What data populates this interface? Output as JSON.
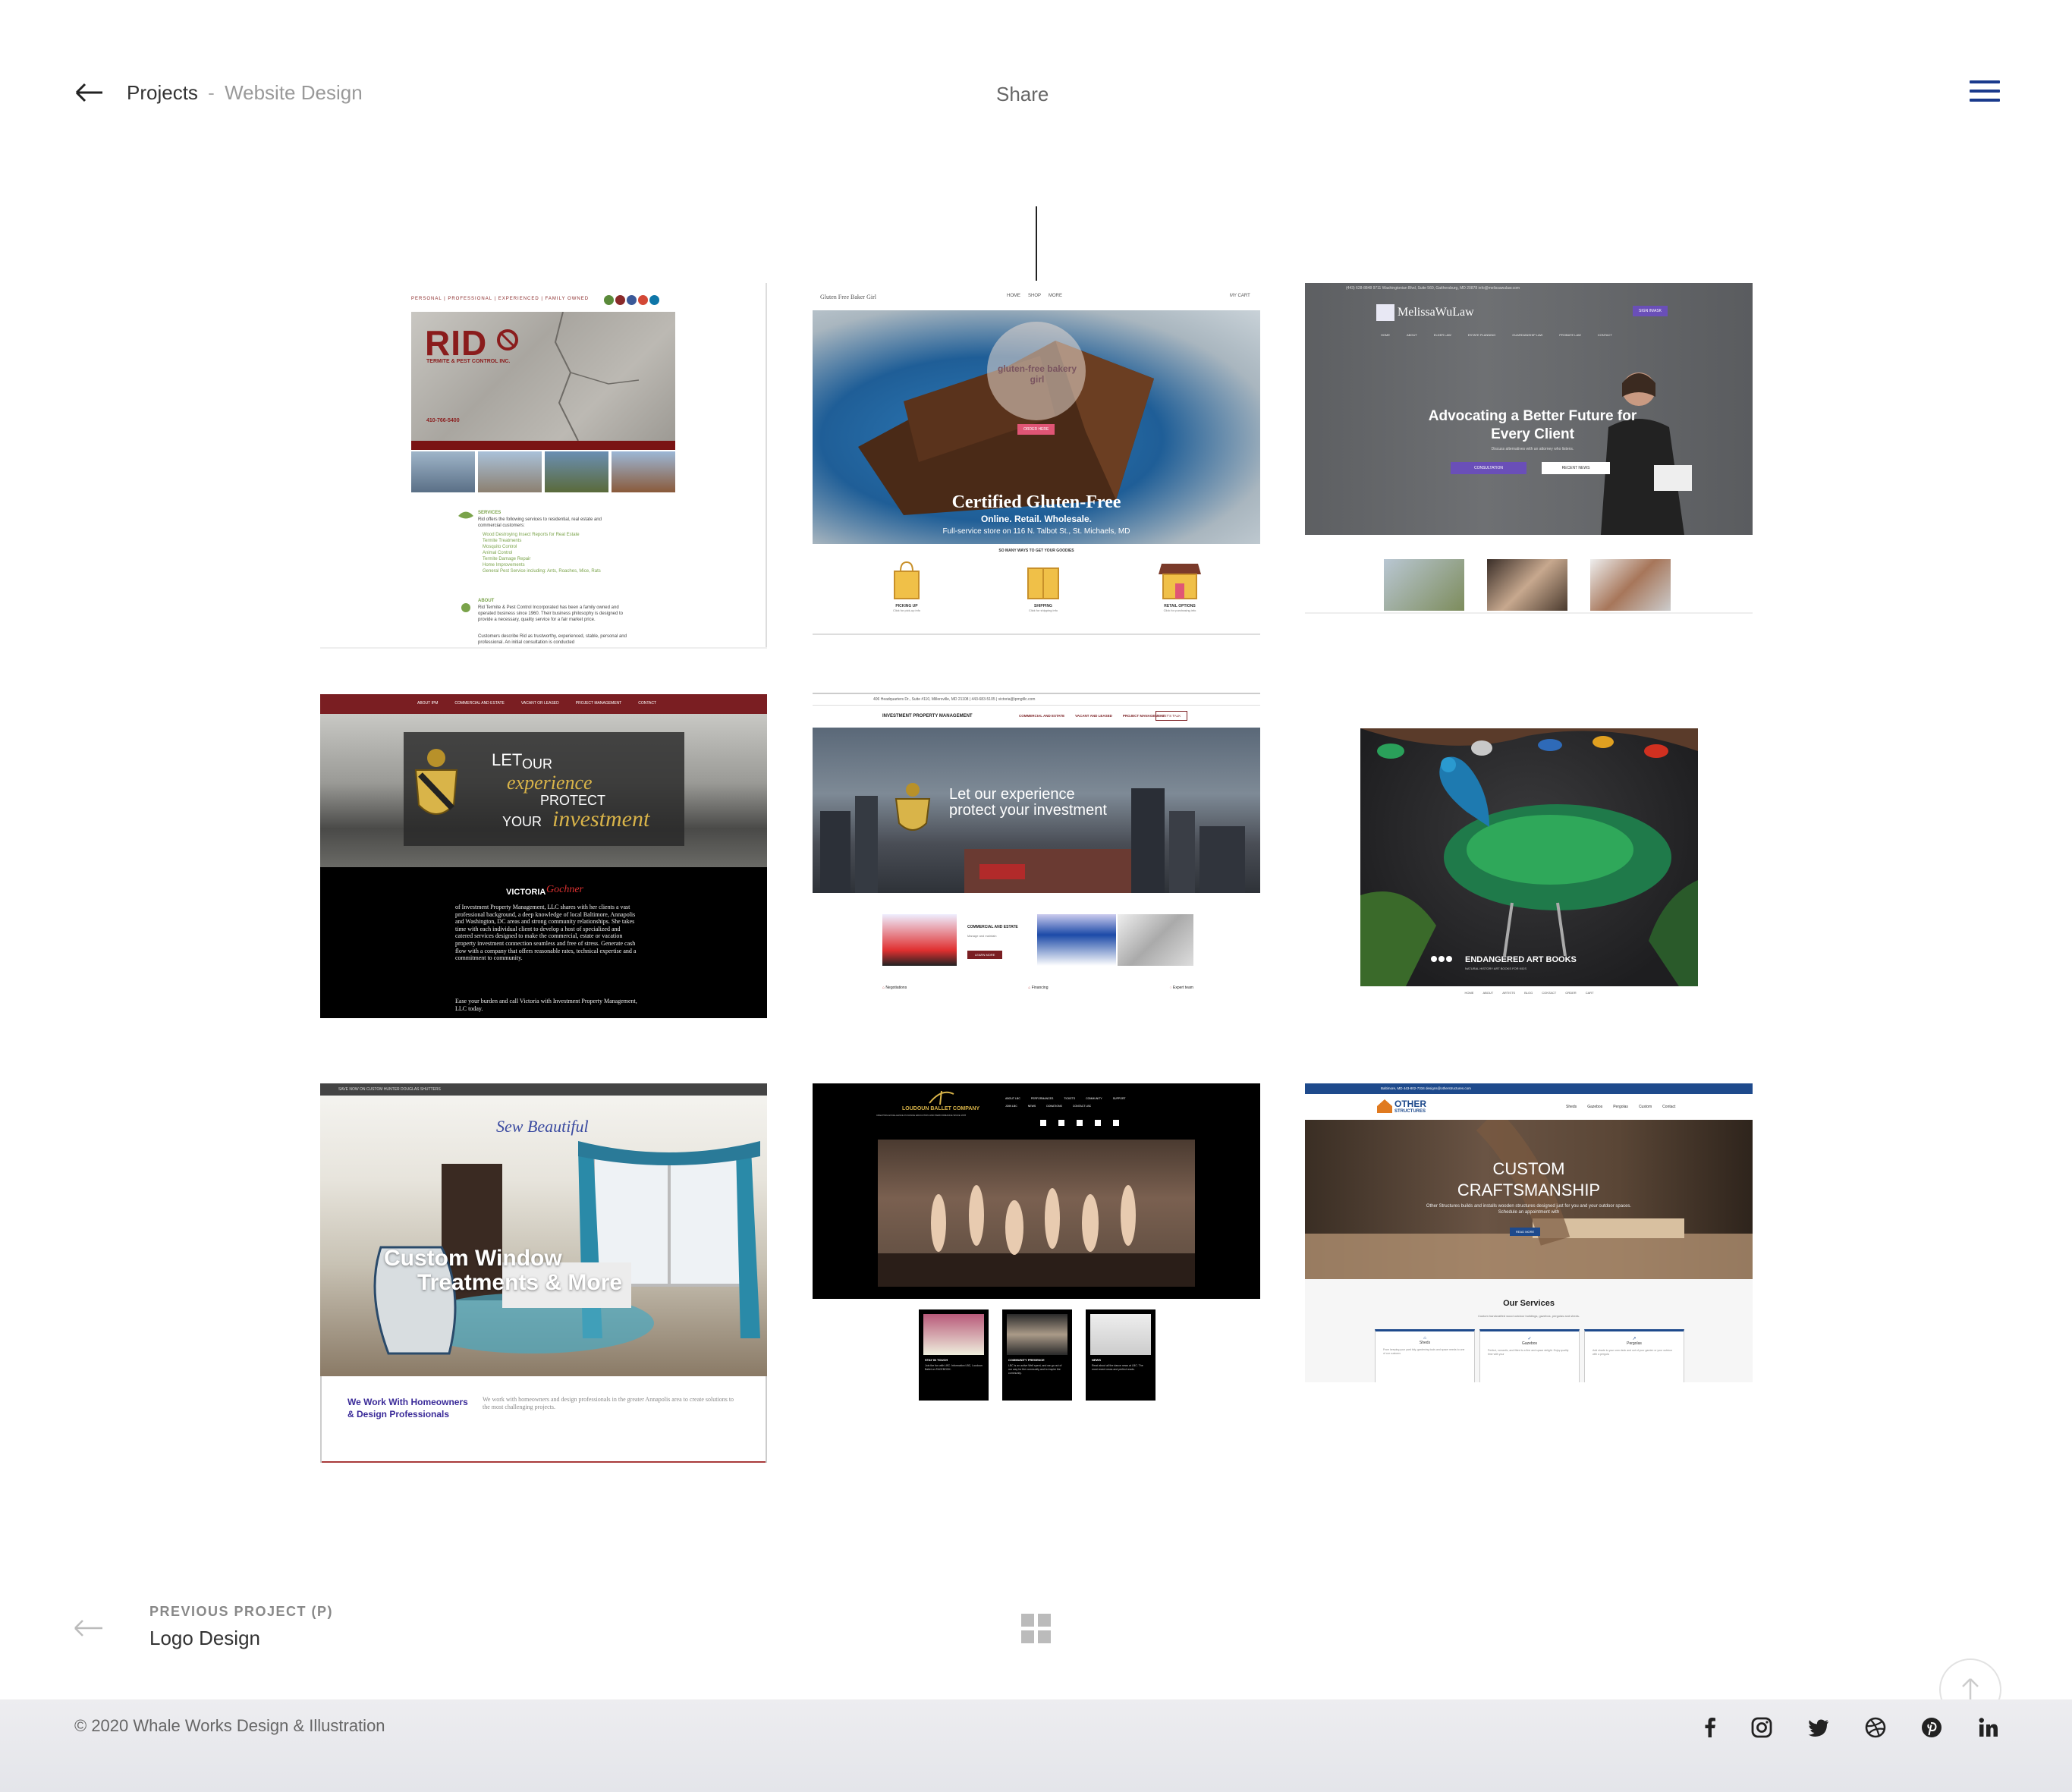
{
  "header": {
    "breadcrumb_projects": "Projects",
    "breadcrumb_separator": "-",
    "breadcrumb_current": "Website Design",
    "share_label": "Share",
    "accent_color": "#1a3a8c"
  },
  "thumbnails": {
    "rid": {
      "tagline": "PERSONAL | PROFESSIONAL | EXPERIENCED | FAMILY OWNED",
      "logo": "RID",
      "logo_sub": "TERMITE & PEST CONTROL INC.",
      "phone": "410-766-5400",
      "services_heading": "SERVICES",
      "services_intro": "Rid offers the following services to residential, real estate and commercial customers:",
      "services": [
        "Wood Destroying Insect Reports for Real Estate",
        "Termite Treatments",
        "Mosquito Control",
        "Animal Control",
        "Termite Damage Repair",
        "Home Improvements",
        "General Pest Service including: Ants, Roaches, Mice, Rats"
      ],
      "about_heading": "ABOUT",
      "about_text": "Rid Termite & Pest Control Incorporated has been a family owned and operated business since 1960. Their business philosophy is designed to provide a necessary, quality service for a fair market price.",
      "about_text2": "Customers describe Rid as trustworthy, experienced, stable, personal and professional. An initial consultation is conducted"
    },
    "bakery": {
      "brand": "Gluten Free Baker Girl",
      "nav": [
        "HOME",
        "SHOP",
        "MORE"
      ],
      "cart": "MY CART",
      "stamp": "gluten-free bakery girl",
      "order_button": "ORDER HERE",
      "headline": "Certified Gluten-Free",
      "subheadline": "Online. Retail. Wholesale.",
      "store_line": "Full-service store on 116 N. Talbot St., St. Michaels, MD",
      "ways_heading": "SO MANY WAYS TO GET YOUR GOODIES",
      "options": [
        "PICKING UP",
        "SHIPPING",
        "RETAIL OPTIONS"
      ],
      "option_notes": [
        "Click for pick-up info",
        "Click for shipping info",
        "Click for purchasing info"
      ]
    },
    "law": {
      "topbar": "(443) 628-8848   9711 Washingtonian Blvd, Suite 560, Gaithersburg, MD 20878   info@melissawulaw.com",
      "logo": "MelissaWuLaw",
      "cta": "SIGN IN/ASK",
      "nav": [
        "HOME",
        "ABOUT",
        "ELDER LAW",
        "ESTATE PLANNING",
        "GUARDIANSHIP LAW",
        "PROBATE LAW",
        "CONTACT"
      ],
      "headline": "Advocating a Better Future for Every Client",
      "subheadline": "Discuss alternatives with an attorney who listens.",
      "button1": "CONSULTATION",
      "button2": "RECENT NEWS"
    },
    "ipm_dark": {
      "nav": [
        "ABOUT IPM",
        "COMMERCIAL AND ESTATE",
        "VACANT OR LEASED",
        "PROJECT MANAGEMENT",
        "CONTACT"
      ],
      "hero_let": "LET",
      "hero_our": "OUR",
      "hero_experience": "experience",
      "hero_protect": "PROTECT",
      "hero_your": "YOUR",
      "hero_investment": "investment",
      "sig_first": "VICTORIA",
      "sig_last": "Gochner",
      "body": "of Investment Property Management, LLC shares with her clients a vast professional background, a deep knowledge of local Baltimore, Annapolis and Washington, DC areas and strong community relationships. She takes time with each individual client to develop a host of specialized and catered services designed to make the commercial, estate or vacation property investment connection seamless and free of stress. Generate cash flow with a company that offers reasonable rates, technical expertise and a commitment to community.",
      "body2": "Ease your burden and call Victoria with Investment Property Management, LLC today."
    },
    "ipm_light": {
      "topbar": "406 Headquarters Dr., Suite #110, Millersville, MD 21108   |   443-683-5105   |   victoria@ipmgtllc.com",
      "brand": "INVESTMENT PROPERTY MANAGEMENT",
      "nav": [
        "COMMERCIAL AND ESTATE",
        "VACANT AND LEASED",
        "PROJECT MANAGEMENT"
      ],
      "cta": "LET'S TALK",
      "hero": "Let our experience protect your investment",
      "card_title": "COMMERCIAL AND ESTATE",
      "card_text": "Manage and maintain",
      "card_button": "LEARN MORE",
      "features": [
        "Negotiations",
        "Financing",
        "Expert team"
      ]
    },
    "books": {
      "brand": "ENDANGERED ART BOOKS",
      "brand_sub": "NATURAL HISTORY ART BOOKS FOR KIDS",
      "nav": [
        "HOME",
        "ABOUT",
        "ARTISTS",
        "BLOG",
        "CONTACT",
        "ORDER",
        "CART"
      ]
    },
    "sew": {
      "topbar": "SAVE NOW ON CUSTOM HUNTER DOUGLAS SHUTTERS",
      "logo": "Sew Beautiful",
      "headline1": "Custom Window",
      "headline2": "Treatments & More",
      "subheading": "We Work With Homeowners & Design Professionals",
      "body": "We work with homeowners and design professionals in the greater Annapolis area to create solutions to the most challenging projects."
    },
    "ballet": {
      "brand": "LOUDOUN BALLET COMPANY",
      "brand_sub": "CREATING EXCELLENCE IN DANCE EDUCATION AND PERFORMANCE SINCE 1978",
      "nav": [
        "ABOUT LBC",
        "PERFORMANCES",
        "TICKETS",
        "COMMUNITY",
        "SUPPORT",
        "JOIN LBC",
        "NEWS",
        "DONATIONS",
        "CONTACT LBC"
      ],
      "cards": [
        {
          "title": "STAY IN TOUCH",
          "text": "Join the fun with LBC. Information LBC, Loudoun Ballet on FACEBOOK."
        },
        {
          "title": "COMMUNITY PRESENCE",
          "text": "LBC is an active Well spent, and we go out of our way for the community and to inspire the community."
        },
        {
          "title": "NEWS",
          "text": "Read about all the dance news at LBC. The most recent news and perfect reads."
        }
      ]
    },
    "other": {
      "topbar": "Baltimore, MD   443-802-7334   designs@otherstructures.com",
      "logo1": "OTHER",
      "logo2": "STRUCTURES",
      "nav": [
        "Sheds",
        "Gazebos",
        "Pergolas",
        "Custom",
        "Contact"
      ],
      "headline1": "CUSTOM",
      "headline2": "CRAFTSMANSHIP",
      "subheadline": "Other Structures builds and installs wooden structures designed just for you and your outdoor spaces. Schedule an appointment with",
      "button": "READ MORE",
      "services_heading": "Our Services",
      "services_intro": "Custom handcrafted wood outdoor buildings, gazebos, pergolas and sheds.",
      "services": [
        "Sheds",
        "Gazebos",
        "Pergolas"
      ],
      "service_notes": [
        "From keeping your yard tidy, gardening tools and space needs to one of our customs",
        "Perfect, romantic, and fitted to a fine and space delight. Enjoy quality time with your",
        "Add shade to your own deck and out of your garden or your outdoor with a pergola"
      ]
    }
  },
  "bottom_nav": {
    "previous_label": "PREVIOUS PROJECT (P)",
    "previous_title": "Logo Design"
  },
  "footer": {
    "copyright": "© 2020 Whale Works Design & Illustration",
    "social_icons": [
      "facebook-icon",
      "instagram-icon",
      "twitter-icon",
      "dribbble-icon",
      "pinterest-icon",
      "linkedin-icon"
    ]
  }
}
